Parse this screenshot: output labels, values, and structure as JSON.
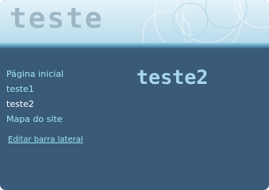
{
  "header": {
    "site_title": "teste"
  },
  "sidebar": {
    "items": [
      {
        "label": "Página inicial",
        "current": false
      },
      {
        "label": "teste1",
        "current": false
      },
      {
        "label": "teste2",
        "current": true
      },
      {
        "label": "Mapa do site",
        "current": false
      }
    ],
    "edit_label": "Editar barra lateral"
  },
  "main": {
    "page_title": "teste2"
  },
  "colors": {
    "background": "#3a5a79",
    "link": "#9fe6f4",
    "current_link": "#ffffff",
    "heading": "#a8d8ee",
    "header_light": "#e4f2f9"
  }
}
